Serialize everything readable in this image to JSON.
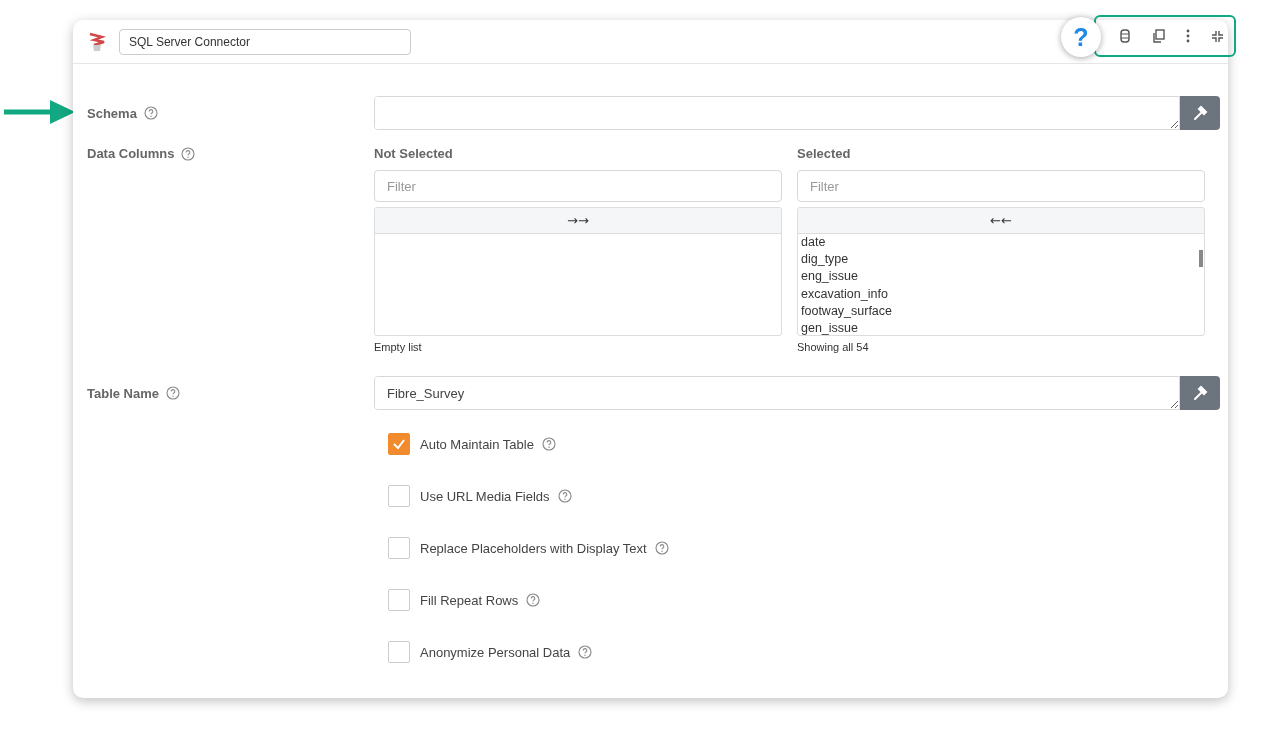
{
  "header": {
    "name_value": "SQL Server Connector",
    "help_glyph": "?"
  },
  "schema": {
    "label": "Schema"
  },
  "data_columns": {
    "label": "Data Columns",
    "not_selected": {
      "heading": "Not Selected",
      "filter_placeholder": "Filter",
      "move_glyph": "→→",
      "caption": "Empty list"
    },
    "selected": {
      "heading": "Selected",
      "filter_placeholder": "Filter",
      "move_glyph": "←←",
      "items": [
        "date",
        "dig_type",
        "eng_issue",
        "excavation_info",
        "footway_surface",
        "gen_issue"
      ],
      "caption": "Showing all 54"
    }
  },
  "table_name": {
    "label": "Table Name",
    "value": "Fibre_Survey"
  },
  "options": [
    {
      "label": "Auto Maintain Table",
      "checked": true
    },
    {
      "label": "Use URL Media Fields",
      "checked": false
    },
    {
      "label": "Replace Placeholders with Display Text",
      "checked": false
    },
    {
      "label": "Fill Repeat Rows",
      "checked": false
    },
    {
      "label": "Anonymize Personal Data",
      "checked": false
    }
  ]
}
